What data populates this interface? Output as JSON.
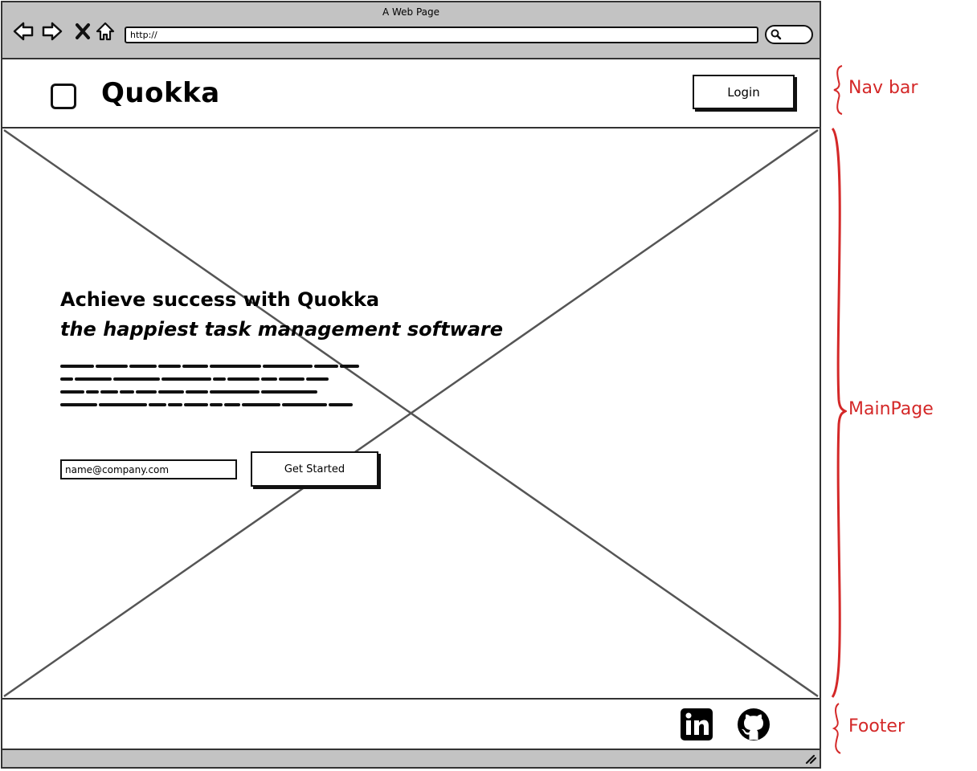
{
  "window": {
    "title": "A Web Page"
  },
  "address_bar": {
    "url": "http://"
  },
  "navbar": {
    "brand": "Quokka",
    "login_label": "Login"
  },
  "hero": {
    "headline": "Achieve success with Quokka",
    "subheadline": "the happiest task management software",
    "email_placeholder": "name@company.com",
    "cta_label": "Get Started"
  },
  "footer": {
    "icons": [
      "linkedin-icon",
      "github-icon"
    ]
  },
  "annotations": {
    "nav": "Nav bar",
    "main": "MainPage",
    "footer": "Footer"
  },
  "colors": {
    "chrome_gray": "#c3c3c3",
    "annotation_red": "#d42828",
    "ink": "#111111"
  }
}
